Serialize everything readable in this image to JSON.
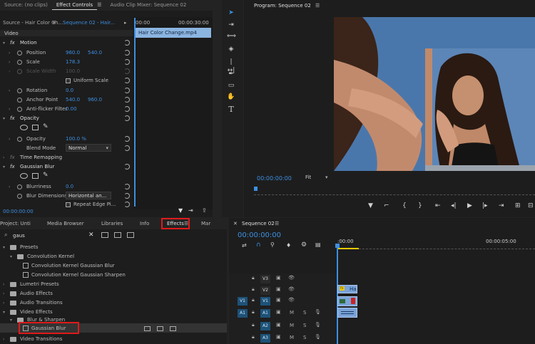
{
  "source_tab": "Source: (no clips)",
  "effect_controls_tab": "Effect Controls",
  "audio_mixer_tab": "Audio Clip Mixer: Sequence 02",
  "program_tab": "Program: Sequence 02",
  "menu_glyph": "☰",
  "ec": {
    "master_clip": "Source - Hair Color Ch...",
    "sequence_clip": "Sequence 02 - Hair...",
    "time_start": "00:00",
    "time_end": "00:00:30:00",
    "clip_name": "Hair Color Change.mp4",
    "video_header": "Video",
    "fx": "fx",
    "motion": "Motion",
    "position": "Position",
    "position_x": "960.0",
    "position_y": "540.0",
    "scale": "Scale",
    "scale_val": "178.3",
    "scale_width": "Scale Width",
    "scale_width_val": "100.0",
    "uniform_scale": "Uniform Scale",
    "rotation": "Rotation",
    "rotation_val": "0.0",
    "anchor_point": "Anchor Point",
    "anchor_x": "540.0",
    "anchor_y": "960.0",
    "anti_flicker": "Anti-flicker Filter",
    "anti_flicker_val": "0.00",
    "opacity_header": "Opacity",
    "opacity": "Opacity",
    "opacity_val": "100.0 %",
    "blend_mode": "Blend Mode",
    "blend_mode_val": "Normal",
    "time_remapping": "Time Remapping",
    "gaussian_blur": "Gaussian Blur",
    "blurriness": "Blurriness",
    "blurriness_val": "0.0",
    "blur_dimensions": "Blur Dimensions",
    "blur_dimensions_val": "Horizontal an...",
    "repeat_edge": "Repeat Edge Pi...",
    "current_time": "00:00:00:00"
  },
  "program": {
    "timecode": "00:00:00:00",
    "fit": "Fit"
  },
  "project_tabs": {
    "project": "Project: Unti",
    "media_browser": "Media Browser",
    "libraries": "Libraries",
    "info": "Info",
    "effects": "Effects",
    "markers": "Mar"
  },
  "search_value": "gaus",
  "effects_tree": {
    "presets": "Presets",
    "convolution_kernel": "Convolution Kernel",
    "ck_gaussian_blur": "Convolution Kernel Gaussian Blur",
    "ck_gaussian_sharpen": "Convolution Kernel Gaussian Sharpen",
    "lumetri_presets": "Lumetri Presets",
    "audio_effects": "Audio Effects",
    "audio_transitions": "Audio Transitions",
    "video_effects": "Video Effects",
    "blur_sharpen": "Blur & Sharpen",
    "gaussian_blur": "Gaussian Blur",
    "video_transitions": "Video Transitions"
  },
  "timeline": {
    "sequence_tab": "Sequence 02",
    "timecode": "00:00:00:00",
    "ruler_start": ":00:00",
    "ruler_mid": "00:00:05:00",
    "tracks": [
      "V3",
      "V2",
      "V1",
      "A1",
      "A2",
      "A3"
    ],
    "source_v1": "V1",
    "source_a1": "A1",
    "m": "M",
    "s": "S",
    "clip_v2_label": "Ha",
    "fx_badge": "fx"
  },
  "colors": {
    "accent_blue": "#3d8fe0",
    "highlight_red": "#e01a1a",
    "clip_blue": "#7aa3d8"
  },
  "icons": [
    "selection-tool-icon",
    "track-select-icon",
    "ripple-edit-icon",
    "razor-icon",
    "slip-icon",
    "pen-icon",
    "rectangle-icon",
    "hand-icon",
    "type-icon",
    "play-icon",
    "step-back-icon",
    "step-forward-icon",
    "mark-in-icon",
    "mark-out-icon",
    "search-icon",
    "close-icon",
    "folder-icon",
    "eye-icon",
    "lock-icon",
    "microphone-icon",
    "wrench-icon",
    "snap-icon",
    "marker-icon",
    "reset-icon",
    "stopwatch-icon",
    "filter-icon"
  ]
}
